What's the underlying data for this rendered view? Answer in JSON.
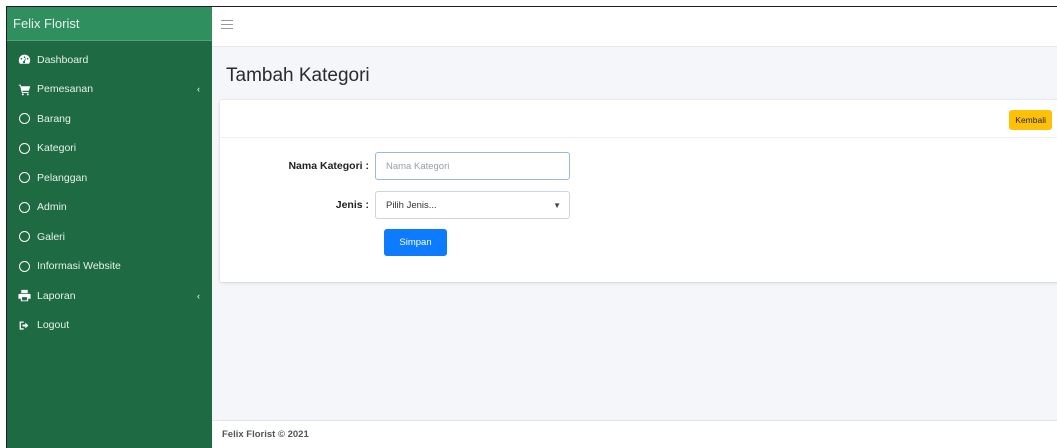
{
  "brand": "Felix Florist",
  "sidebar": {
    "items": [
      {
        "label": "Dashboard",
        "icon": "dashboard-icon"
      },
      {
        "label": "Pemesanan",
        "icon": "cart-icon",
        "chevron": "‹"
      },
      {
        "label": "Barang",
        "icon": "circle-icon"
      },
      {
        "label": "Kategori",
        "icon": "circle-icon"
      },
      {
        "label": "Pelanggan",
        "icon": "circle-icon"
      },
      {
        "label": "Admin",
        "icon": "circle-icon"
      },
      {
        "label": "Galeri",
        "icon": "circle-icon"
      },
      {
        "label": "Informasi Website",
        "icon": "circle-icon"
      },
      {
        "label": "Laporan",
        "icon": "print-icon",
        "chevron": "‹"
      },
      {
        "label": "Logout",
        "icon": "sign-out-icon"
      }
    ]
  },
  "page": {
    "title": "Tambah Kategori",
    "back_button": "Kembali"
  },
  "form": {
    "nama_label": "Nama Kategori :",
    "nama_value": "",
    "nama_placeholder": "Nama Kategori",
    "jenis_label": "Jenis :",
    "jenis_selected": "Pilih Jenis...",
    "submit_label": "Simpan"
  },
  "footer": "Felix Florist © 2021",
  "colors": {
    "sidebar": "#1e6b43",
    "brand_bar": "#2f8f5f",
    "back_button": "#ffc107",
    "submit_button": "#0d7bff"
  }
}
